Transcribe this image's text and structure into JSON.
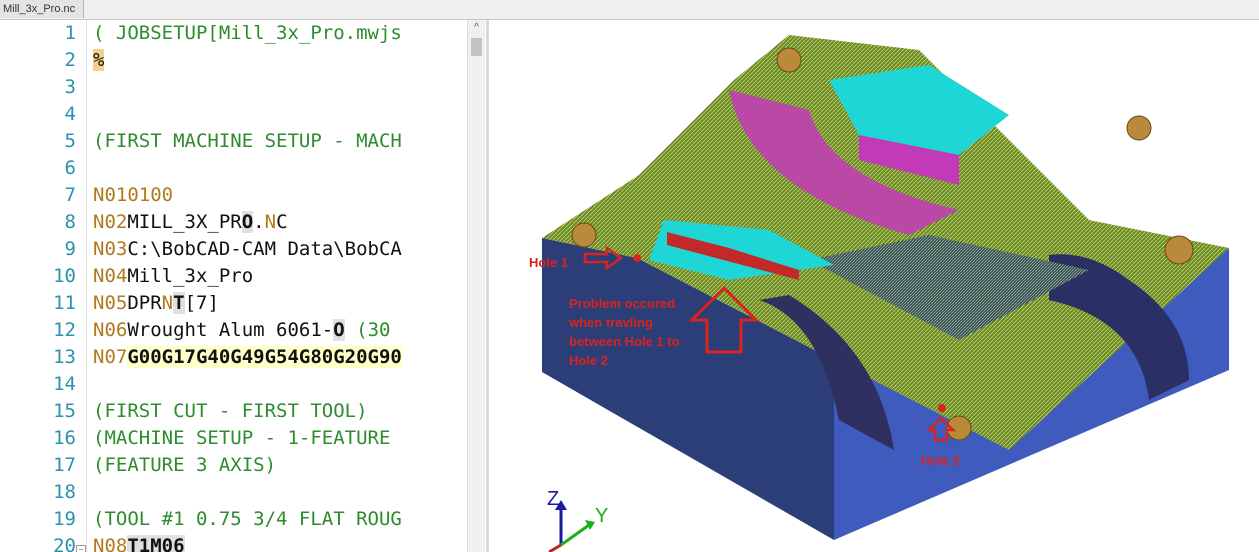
{
  "tab": {
    "label": "Mill_3x_Pro.nc"
  },
  "editor": {
    "lines": [
      {
        "num": "1",
        "parts": [
          {
            "t": "( JOBSETUP[Mill_3x_Pro.mwjs",
            "c": "green"
          }
        ]
      },
      {
        "num": "2",
        "parts": [
          {
            "t": "%",
            "c": "black",
            "hl": "orange"
          }
        ]
      },
      {
        "num": "3",
        "parts": []
      },
      {
        "num": "4",
        "parts": []
      },
      {
        "num": "5",
        "parts": [
          {
            "t": "(FIRST MACHINE SETUP - MACH",
            "c": "green"
          }
        ]
      },
      {
        "num": "6",
        "parts": []
      },
      {
        "num": "7",
        "parts": [
          {
            "t": "N010100",
            "c": "gold"
          }
        ]
      },
      {
        "num": "8",
        "parts": [
          {
            "t": "N02",
            "c": "gold"
          },
          {
            "t": "MILL_3X_PR",
            "c": "black"
          },
          {
            "t": "O",
            "c": "black",
            "hl": "grey"
          },
          {
            "t": ".",
            "c": "black"
          },
          {
            "t": "N",
            "c": "gold"
          },
          {
            "t": "C",
            "c": "black"
          }
        ]
      },
      {
        "num": "9",
        "parts": [
          {
            "t": "N03",
            "c": "gold"
          },
          {
            "t": "C:\\BobCAD-CAM Data\\BobCA",
            "c": "black"
          }
        ]
      },
      {
        "num": "10",
        "parts": [
          {
            "t": "N04",
            "c": "gold"
          },
          {
            "t": "Mill_3x_Pro",
            "c": "black"
          }
        ]
      },
      {
        "num": "11",
        "parts": [
          {
            "t": "N05",
            "c": "gold"
          },
          {
            "t": "DPR",
            "c": "black"
          },
          {
            "t": "N",
            "c": "gold"
          },
          {
            "t": "T",
            "c": "black",
            "hl": "grey"
          },
          {
            "t": "[7]",
            "c": "black"
          }
        ]
      },
      {
        "num": "12",
        "parts": [
          {
            "t": "N06",
            "c": "gold"
          },
          {
            "t": "Wrought Alum 6061-",
            "c": "black"
          },
          {
            "t": "O",
            "c": "black",
            "hl": "grey"
          },
          {
            "t": " (30",
            "c": "green"
          }
        ]
      },
      {
        "num": "13",
        "parts": [
          {
            "t": "N07",
            "c": "gold"
          },
          {
            "t": "G00G17G40G49G54G80G20G90",
            "c": "black",
            "hl": "yellow"
          }
        ]
      },
      {
        "num": "14",
        "parts": []
      },
      {
        "num": "15",
        "parts": [
          {
            "t": "(FIRST CUT - FIRST TOOL)",
            "c": "green"
          }
        ]
      },
      {
        "num": "16",
        "parts": [
          {
            "t": "(MACHINE SETUP - 1-FEATURE",
            "c": "green"
          }
        ]
      },
      {
        "num": "17",
        "parts": [
          {
            "t": "(FEATURE 3 AXIS)",
            "c": "green"
          }
        ]
      },
      {
        "num": "18",
        "parts": []
      },
      {
        "num": "19",
        "parts": [
          {
            "t": "(TOOL #1 0.75 3/4 FLAT ROUG",
            "c": "green"
          }
        ]
      },
      {
        "num": "20",
        "parts": [
          {
            "t": "N08",
            "c": "gold"
          },
          {
            "t": "T1M06",
            "c": "black",
            "hl": "grey"
          }
        ]
      }
    ]
  },
  "annotations": {
    "hole1": "Hole 1",
    "hole2": "Hole 2",
    "problem_line1": "Problem occured",
    "problem_line2": "when travling",
    "problem_line3": "between Hole 1 to",
    "problem_line4": "Hole 2"
  },
  "axes": {
    "z": "Z",
    "y": "Y"
  },
  "colors": {
    "annotation": "#d9231f",
    "part_blue": "#3b4f9e",
    "part_green": "#6b8a2a",
    "cyan": "#1fd6d6",
    "magenta": "#c23ab7"
  }
}
